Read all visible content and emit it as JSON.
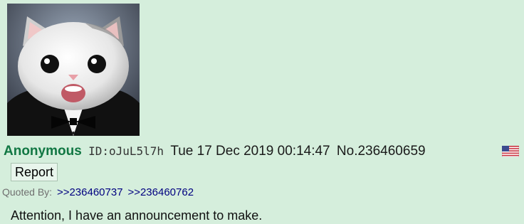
{
  "post": {
    "name": "Anonymous",
    "poster_id": "ID:oJuL5l7h",
    "date": "Tue 17 Dec 2019 00:14:47",
    "number": "No.236460659",
    "flag": "us-flag-icon",
    "report_label": "Report",
    "quoted_by_label": "Quoted By:",
    "quoted_by": [
      ">>236460737",
      ">>236460762"
    ],
    "message": "Attention, I have an announcement to make."
  },
  "colors": {
    "background": "#d5eedc",
    "name": "#117743",
    "quotelink": "#000080"
  }
}
